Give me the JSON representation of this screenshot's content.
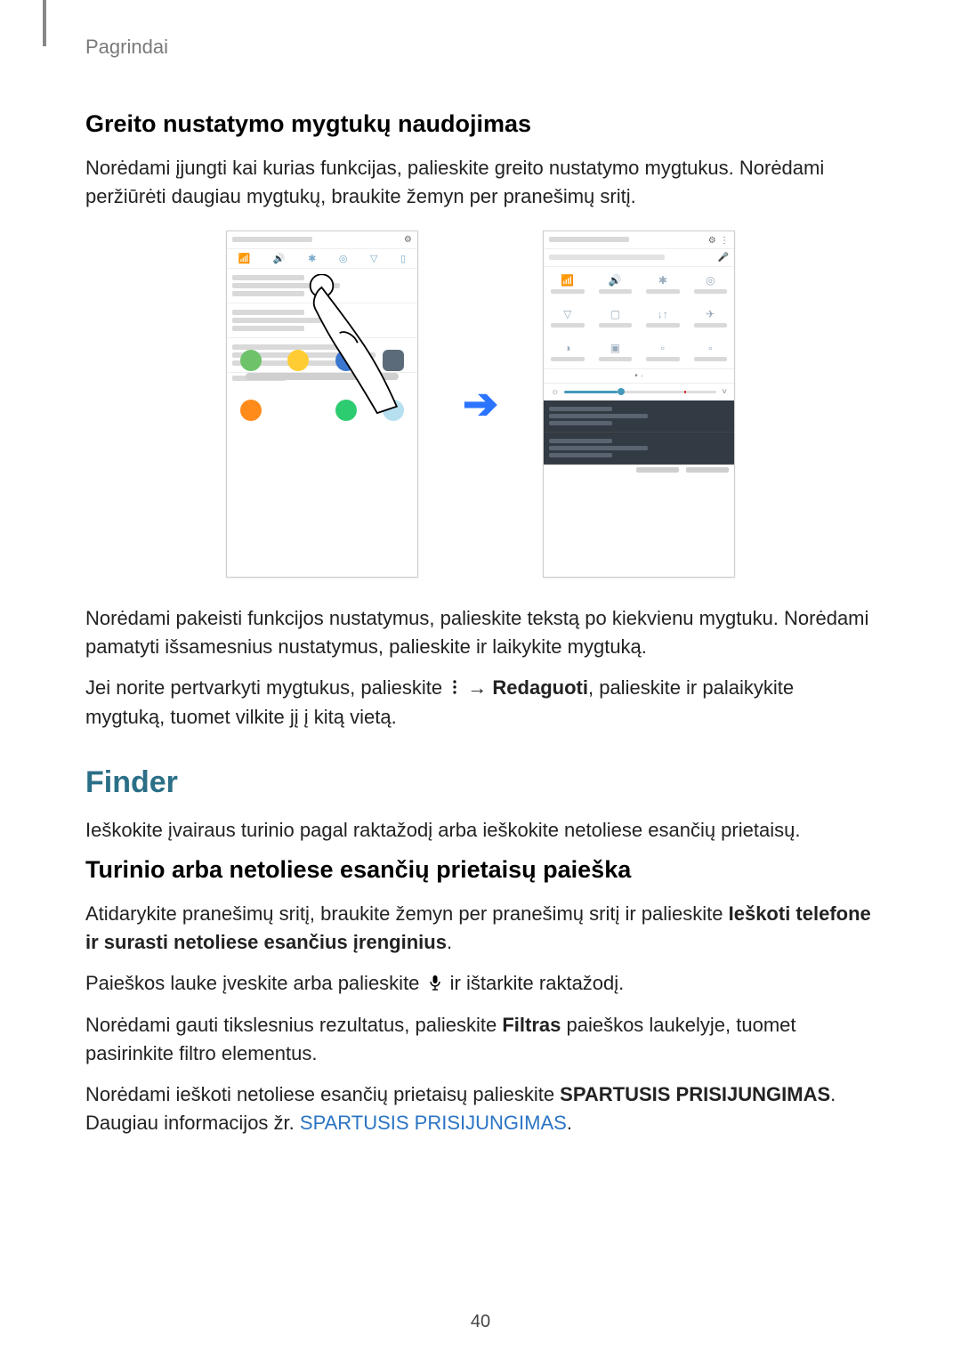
{
  "header": {
    "breadcrumb": "Pagrindai"
  },
  "section1": {
    "heading": "Greito nustatymo mygtukų naudojimas",
    "p1": "Norėdami įjungti kai kurias funkcijas, palieskite greito nustatymo mygtukus. Norėdami peržiūrėti daugiau mygtukų, braukite žemyn per pranešimų sritį.",
    "p2": "Norėdami pakeisti funkcijos nustatymus, palieskite tekstą po kiekvienu mygtuku. Norėdami pamatyti išsamesnius nustatymus, palieskite ir laikykite mygtuką.",
    "p3_pre": "Jei norite pertvarkyti mygtukus, palieskite ",
    "p3_arrow": " → ",
    "p3_bold": "Redaguoti",
    "p3_post": ", palieskite ir palaikykite mygtuką, tuomet vilkite jį į kitą vietą."
  },
  "section2": {
    "heading": "Finder",
    "intro": "Ieškokite įvairaus turinio pagal raktažodį arba ieškokite netoliese esančių prietaisų.",
    "sub": "Turinio arba netoliese esančių prietaisų paieška",
    "p1_pre": "Atidarykite pranešimų sritį, braukite žemyn per pranešimų sritį ir palieskite ",
    "p1_bold": "Ieškoti telefone ir surasti netoliese esančius įrenginius",
    "p1_post": ".",
    "p2_pre": "Paieškos lauke įveskite arba palieskite ",
    "p2_post": " ir ištarkite raktažodį.",
    "p3_pre": "Norėdami gauti tikslesnius rezultatus, palieskite ",
    "p3_bold": "Filtras",
    "p3_post": " paieškos laukelyje, tuomet pasirinkite filtro elementus.",
    "p4_pre": "Norėdami ieškoti netoliese esančių prietaisų palieskite ",
    "p4_bold": "SPARTUSIS PRISIJUNGIMAS",
    "p4_mid": ". Daugiau informacijos žr. ",
    "p4_link": "SPARTUSIS PRISIJUNGIMAS",
    "p4_post": "."
  },
  "page_number": "40"
}
